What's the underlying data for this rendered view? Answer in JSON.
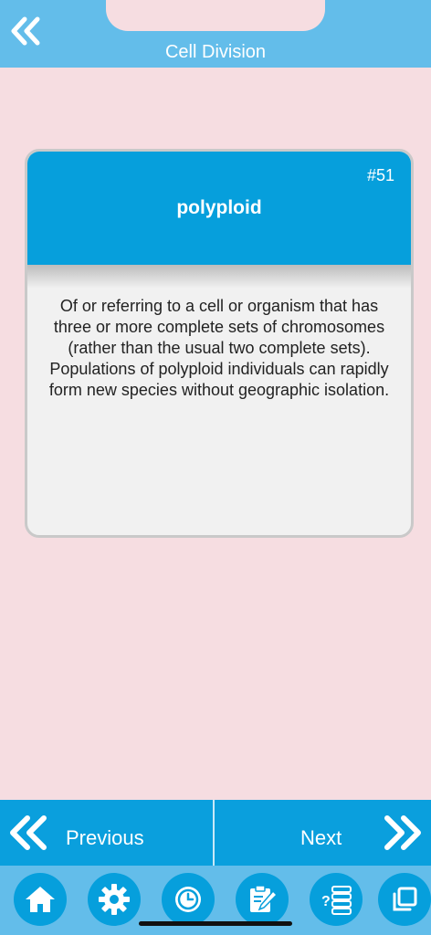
{
  "header": {
    "title": "Cell Division",
    "back_icon": "double-chevron-left-icon"
  },
  "card": {
    "number": "#51",
    "term": "polyploid",
    "definition": "Of or referring to a cell or organism that has three or more complete sets of chromosomes (rather than the usual two complete sets). Populations of polyploid individuals can rapidly form new species without geographic isolation."
  },
  "nav": {
    "previous_label": "Previous",
    "next_label": "Next"
  },
  "tabs": [
    {
      "icon": "home-icon"
    },
    {
      "icon": "gear-icon"
    },
    {
      "icon": "clock-icon"
    },
    {
      "icon": "notes-icon"
    },
    {
      "icon": "quiz-list-icon"
    },
    {
      "icon": "cards-icon"
    }
  ],
  "colors": {
    "header": "#63bdea",
    "accent": "#069fdc",
    "background": "#f6dde1",
    "card": "#f1f1f1"
  }
}
